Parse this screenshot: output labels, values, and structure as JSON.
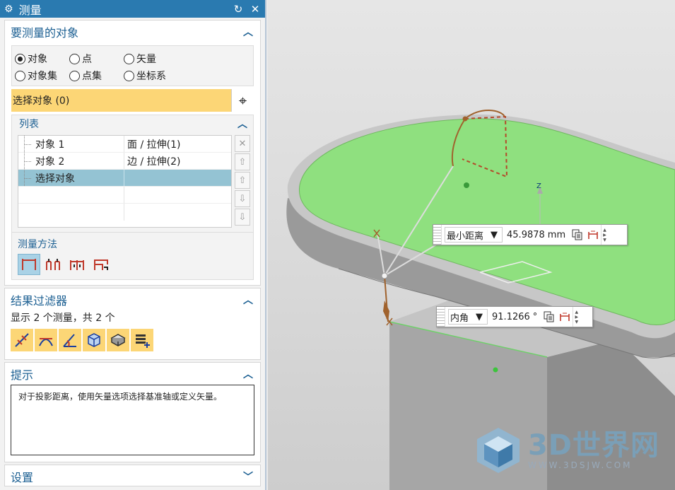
{
  "titlebar": {
    "title": "测量",
    "gear_icon": "gear-icon",
    "reset_icon": "reset-icon",
    "close_icon": "close-icon"
  },
  "objects_section": {
    "title": "要测量的对象",
    "radios": [
      {
        "label": "对象",
        "checked": true
      },
      {
        "label": "点",
        "checked": false
      },
      {
        "label": "矢量",
        "checked": false
      },
      {
        "label": "对象集",
        "checked": false
      },
      {
        "label": "点集",
        "checked": false
      },
      {
        "label": "坐标系",
        "checked": false
      }
    ],
    "select_label": "选择对象 (0)",
    "list": {
      "title": "列表",
      "rows": [
        {
          "name": "对象 1",
          "type": "面 / 拉伸(1)"
        },
        {
          "name": "对象 2",
          "type": "边 / 拉伸(2)"
        },
        {
          "name": "选择对象",
          "type": ""
        }
      ]
    },
    "method_label": "测量方法"
  },
  "filter_section": {
    "title": "结果过滤器",
    "summary": "显示 2 个测量，共 2 个"
  },
  "hint_section": {
    "title": "提示",
    "text": "对于投影距离，使用矢量选项选择基准轴或定义矢量。"
  },
  "settings_section": {
    "title": "设置"
  },
  "viewport": {
    "distance_label": {
      "type": "最小距离",
      "value": "45.9878",
      "unit": "mm"
    },
    "angle_label": {
      "type": "内角",
      "value": "91.1266",
      "unit": "°"
    },
    "axis_label": "Z",
    "colors": {
      "face": "#8fe07f",
      "body": "#9c9c9c",
      "accent": "#2a7ab0",
      "highlight": "#fcd676"
    }
  },
  "watermark": {
    "big": "3D世界网",
    "small": "WWW.3DSJW.COM"
  }
}
